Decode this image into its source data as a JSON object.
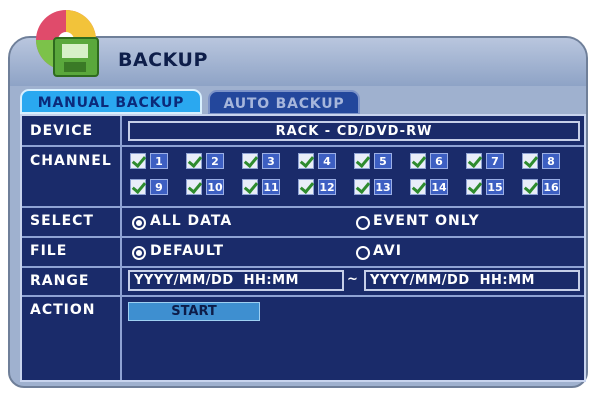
{
  "window": {
    "title": "BACKUP"
  },
  "tabs": [
    {
      "label": "MANUAL BACKUP",
      "active": true
    },
    {
      "label": "AUTO BACKUP",
      "active": false
    }
  ],
  "rows": {
    "device": {
      "label": "DEVICE",
      "value": "RACK - CD/DVD-RW"
    },
    "channel": {
      "label": "CHANNEL",
      "channels": [
        "1",
        "2",
        "3",
        "4",
        "5",
        "6",
        "7",
        "8",
        "9",
        "10",
        "11",
        "12",
        "13",
        "14",
        "15",
        "16"
      ],
      "all_checked": true
    },
    "select": {
      "label": "SELECT",
      "options": [
        "ALL DATA",
        "EVENT ONLY"
      ],
      "selected": "ALL DATA"
    },
    "file": {
      "label": "FILE",
      "options": [
        "DEFAULT",
        "AVI"
      ],
      "selected": "DEFAULT"
    },
    "range": {
      "label": "RANGE",
      "from": "YYYY/MM/DD  HH:MM",
      "separator": "~",
      "to": "YYYY/MM/DD  HH:MM"
    },
    "action": {
      "label": "ACTION",
      "button": "START"
    }
  },
  "colors": {
    "panel_bg": "#1a2b6a",
    "active_tab": "#2aa8f0",
    "start_button": "#3e8fd0"
  }
}
